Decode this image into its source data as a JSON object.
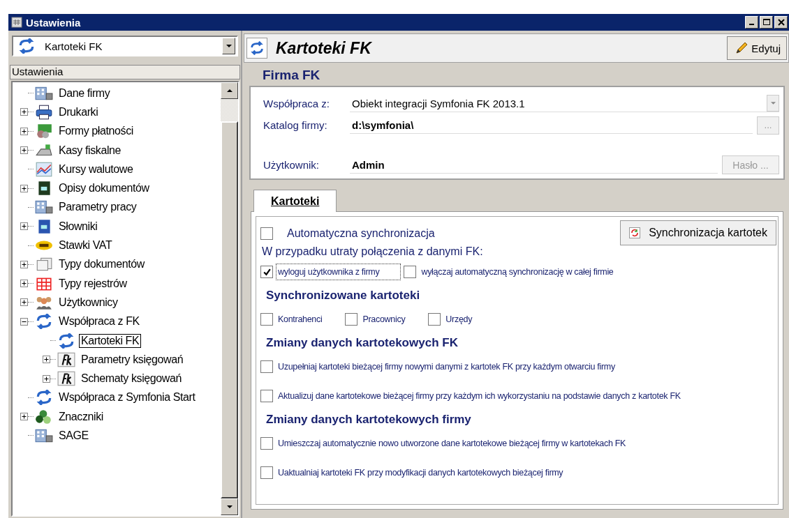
{
  "window": {
    "title": "Ustawienia"
  },
  "left_panel": {
    "combo": {
      "value": "Kartoteki FK"
    },
    "header": "Ustawienia",
    "tree": [
      {
        "label": "Dane firmy",
        "kind": "leaf",
        "selected": false
      },
      {
        "label": "Drukarki",
        "kind": "branch",
        "expanded": false,
        "selected": false
      },
      {
        "label": "Formy płatności",
        "kind": "branch",
        "expanded": false,
        "selected": false
      },
      {
        "label": "Kasy fiskalne",
        "kind": "branch",
        "expanded": false,
        "selected": false
      },
      {
        "label": "Kursy walutowe",
        "kind": "leaf",
        "selected": false
      },
      {
        "label": "Opisy dokumentów",
        "kind": "branch",
        "expanded": false,
        "selected": false
      },
      {
        "label": "Parametry pracy",
        "kind": "leaf",
        "selected": false
      },
      {
        "label": "Słowniki",
        "kind": "branch",
        "expanded": false,
        "selected": false
      },
      {
        "label": "Stawki VAT",
        "kind": "leaf",
        "selected": false
      },
      {
        "label": "Typy dokumentów",
        "kind": "branch",
        "expanded": false,
        "selected": false
      },
      {
        "label": "Typy rejestrów",
        "kind": "branch",
        "expanded": false,
        "selected": false
      },
      {
        "label": "Użytkownicy",
        "kind": "branch",
        "expanded": false,
        "selected": false
      },
      {
        "label": "Współpraca z FK",
        "kind": "branch",
        "expanded": true,
        "selected": false,
        "children": [
          {
            "label": "Kartoteki FK",
            "kind": "leaf",
            "selected": true
          },
          {
            "label": "Parametry księgowań",
            "kind": "branch",
            "expanded": false,
            "selected": false
          },
          {
            "label": "Schematy księgowań",
            "kind": "branch",
            "expanded": false,
            "selected": false
          }
        ]
      },
      {
        "label": "Współpraca z Symfonia Start",
        "kind": "leaf",
        "selected": false
      },
      {
        "label": "Znaczniki",
        "kind": "branch",
        "expanded": false,
        "selected": false
      },
      {
        "label": "SAGE",
        "kind": "leaf",
        "selected": false
      }
    ]
  },
  "right_panel": {
    "title": "Kartoteki FK",
    "edit_button": "Edytuj",
    "section_title": "Firma FK",
    "fields": [
      {
        "label": "Współpraca z:",
        "value": "Obiekt integracji Symfonia FK 2013.1",
        "kind": "combo"
      },
      {
        "label": "Katalog firmy:",
        "value": "d:\\symfonia\\",
        "kind": "browse",
        "button": "..."
      },
      {
        "label": "Użytkownik:",
        "value": "Admin",
        "kind": "password",
        "button": "Hasło ...",
        "disabled": true
      }
    ],
    "tabs": [
      {
        "label": "Kartoteki",
        "selected": true
      }
    ],
    "auto_sync": {
      "label": "Automatyczna synchronizacja",
      "checked": false
    },
    "sync_button": "Synchronizacja kartotek",
    "connection_loss": {
      "label": "W przypadku utraty połączenia z danymi FK:",
      "options": [
        {
          "label": "wyloguj użytkownika z firmy",
          "checked": true,
          "focused": true
        },
        {
          "label": "wyłączaj automatyczną synchronizację w całej firmie",
          "checked": false,
          "focused": false
        }
      ]
    },
    "sections": [
      {
        "title": "Synchronizowane kartoteki",
        "kind": "row",
        "options": [
          {
            "label": "Kontrahenci",
            "checked": false
          },
          {
            "label": "Pracownicy",
            "checked": false
          },
          {
            "label": "Urzędy",
            "checked": false
          }
        ]
      },
      {
        "title": "Zmiany danych kartotekowych FK",
        "kind": "column",
        "options": [
          {
            "label": "Uzupełniaj kartoteki bieżącej firmy nowymi danymi z kartotek FK przy każdym otwarciu firmy",
            "checked": false
          },
          {
            "label": "Aktualizuj dane kartotekowe bieżącej firmy przy każdym ich wykorzystaniu na podstawie danych z kartotek FK",
            "checked": false
          }
        ]
      },
      {
        "title": "Zmiany danych kartotekowych firmy",
        "kind": "column",
        "options": [
          {
            "label": "Umieszczaj automatycznie nowo utworzone dane kartotekowe bieżącej firmy w kartotekach FK",
            "checked": false
          },
          {
            "label": "Uaktualniaj kartoteki FK przy modyfikacji danych kartotekowych bieżącej firmy",
            "checked": false
          }
        ]
      }
    ]
  }
}
